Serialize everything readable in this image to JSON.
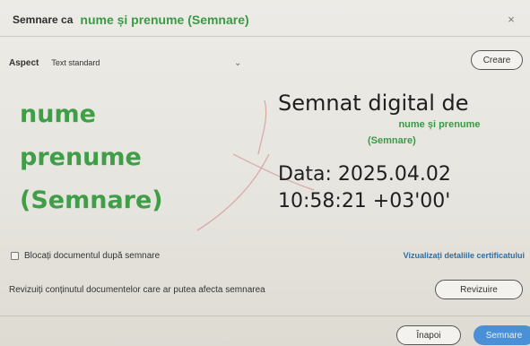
{
  "header": {
    "prefix": "Semnare ca",
    "signer": "nume și prenume (Semnare)",
    "close_symbol": "×"
  },
  "aspect": {
    "label": "Aspect",
    "selected": "Text standard",
    "chevron": "⌄"
  },
  "buttons": {
    "create": "Creare",
    "review": "Revizuire",
    "back": "Înapoi",
    "sign": "Semnare"
  },
  "preview": {
    "name_line1": "nume",
    "name_line2": "prenume",
    "name_line3": "(Semnare)",
    "signed_title": "Semnat digital de",
    "signer_line1": "nume și prenume",
    "signer_line2": "(Semnare)",
    "date_line1": "Data: 2025.04.02",
    "date_line2": "10:58:21 +03'00'"
  },
  "options": {
    "lock_label": "Blocați documentul după semnare",
    "lock_checked": false,
    "cert_link": "Vizualizați detaliile certificatului"
  },
  "review": {
    "text": "Revizuiți conținutul documentelor care ar putea afecta semnarea"
  },
  "colors": {
    "accent_green": "#3f9e47",
    "primary_blue": "#4a90d6",
    "link_blue": "#2a6fa8"
  }
}
